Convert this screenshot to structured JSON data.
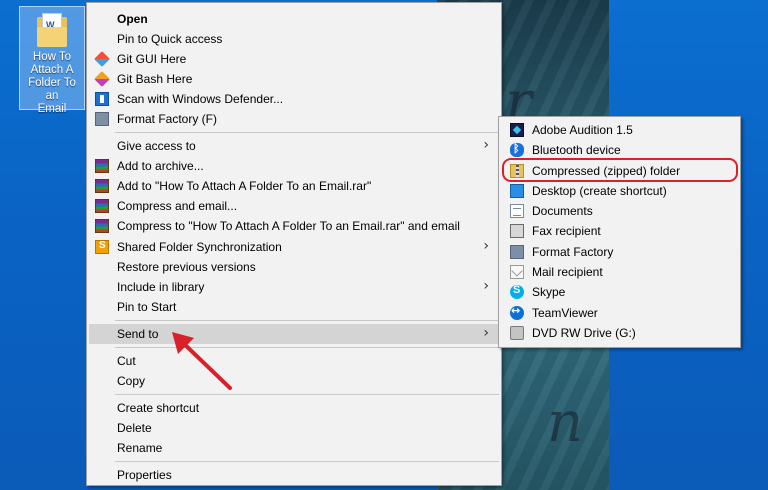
{
  "desktop": {
    "icon_label_lines": [
      "How To",
      "Attach A",
      "Folder To an",
      "Email"
    ],
    "icon_name": "word-document-folder-icon"
  },
  "context_menu": {
    "items": [
      {
        "label": "Open",
        "bold": true,
        "icon": ""
      },
      {
        "label": "Pin to Quick access",
        "icon": ""
      },
      {
        "label": "Git GUI Here",
        "icon": "git-gui-icon"
      },
      {
        "label": "Git Bash Here",
        "icon": "git-bash-icon"
      },
      {
        "label": "Scan with Windows Defender...",
        "icon": "windows-defender-icon"
      },
      {
        "label": "Format Factory (F)",
        "icon": "format-factory-icon"
      },
      {
        "label": "Give access to",
        "icon": "",
        "submenu": true
      },
      {
        "label": "Add to archive...",
        "icon": "winrar-icon"
      },
      {
        "label": "Add to \"How To Attach A Folder To an Email.rar\"",
        "icon": "winrar-icon"
      },
      {
        "label": "Compress and email...",
        "icon": "winrar-icon"
      },
      {
        "label": "Compress to \"How To Attach A Folder To an Email.rar\" and email",
        "icon": "winrar-icon"
      },
      {
        "label": "Shared Folder Synchronization",
        "icon": "shared-sync-icon",
        "submenu": true
      },
      {
        "label": "Restore previous versions",
        "icon": ""
      },
      {
        "label": "Include in library",
        "icon": "",
        "submenu": true
      },
      {
        "label": "Pin to Start",
        "icon": ""
      },
      {
        "label": "Send to",
        "icon": "",
        "submenu": true,
        "highlighted": true
      },
      {
        "label": "Cut",
        "icon": ""
      },
      {
        "label": "Copy",
        "icon": ""
      },
      {
        "label": "Create shortcut",
        "icon": ""
      },
      {
        "label": "Delete",
        "icon": ""
      },
      {
        "label": "Rename",
        "icon": ""
      },
      {
        "label": "Properties",
        "icon": ""
      }
    ],
    "submenu_arrow": "›"
  },
  "send_to_menu": {
    "items": [
      {
        "label": "Adobe Audition 1.5",
        "icon": "adobe-audition-icon"
      },
      {
        "label": "Bluetooth device",
        "icon": "bluetooth-icon"
      },
      {
        "label": "Compressed (zipped) folder",
        "icon": "zip-folder-icon",
        "circled": true
      },
      {
        "label": "Desktop (create shortcut)",
        "icon": "desktop-icon"
      },
      {
        "label": "Documents",
        "icon": "documents-icon"
      },
      {
        "label": "Fax recipient",
        "icon": "fax-icon"
      },
      {
        "label": "Format Factory",
        "icon": "format-factory-icon"
      },
      {
        "label": "Mail recipient",
        "icon": "mail-icon"
      },
      {
        "label": "Skype",
        "icon": "skype-icon"
      },
      {
        "label": "TeamViewer",
        "icon": "teamviewer-icon"
      },
      {
        "label": "DVD RW Drive (G:)",
        "icon": "dvd-drive-icon"
      }
    ]
  },
  "colors": {
    "annotation_red": "#d9212a",
    "menu_background": "#f2f2f2",
    "desktop_blue": "#0b6fd0"
  }
}
